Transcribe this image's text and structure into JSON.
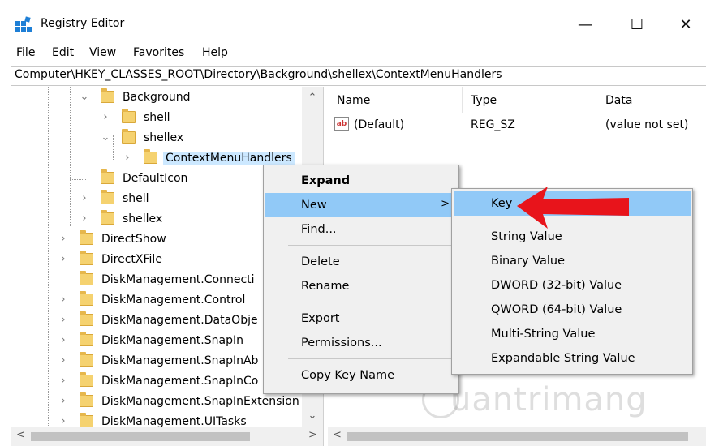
{
  "window": {
    "title": "Registry Editor",
    "controls": {
      "minimize": "—",
      "maximize": "☐",
      "close": "✕"
    }
  },
  "menubar": [
    "File",
    "Edit",
    "View",
    "Favorites",
    "Help"
  ],
  "address": "Computer\\HKEY_CLASSES_ROOT\\Directory\\Background\\shellex\\ContextMenuHandlers",
  "tree": [
    {
      "label": "Background",
      "expander": "⌄"
    },
    {
      "label": "shell",
      "expander": "›"
    },
    {
      "label": "shellex",
      "expander": "⌄"
    },
    {
      "label": "ContextMenuHandlers",
      "expander": "›",
      "selected": true
    },
    {
      "label": "DefaultIcon",
      "expander": ""
    },
    {
      "label": "shell",
      "expander": "›"
    },
    {
      "label": "shellex",
      "expander": "›"
    },
    {
      "label": "DirectShow",
      "expander": "›"
    },
    {
      "label": "DirectXFile",
      "expander": "›"
    },
    {
      "label": "DiskManagement.Connecti",
      "expander": ""
    },
    {
      "label": "DiskManagement.Control",
      "expander": "›"
    },
    {
      "label": "DiskManagement.DataObje",
      "expander": "›"
    },
    {
      "label": "DiskManagement.SnapIn",
      "expander": "›"
    },
    {
      "label": "DiskManagement.SnapInAb",
      "expander": "›"
    },
    {
      "label": "DiskManagement.SnapInCo",
      "expander": "›"
    },
    {
      "label": "DiskManagement.SnapInExtension",
      "expander": "›"
    },
    {
      "label": "DiskManagement.UITasks",
      "expander": "›"
    }
  ],
  "list": {
    "columns": [
      "Name",
      "Type",
      "Data"
    ],
    "rows": [
      {
        "icon": "ab",
        "name": "(Default)",
        "type": "REG_SZ",
        "data": "(value not set)"
      }
    ]
  },
  "context_menu": {
    "items": [
      "Expand",
      "New",
      "Find...",
      "Delete",
      "Rename",
      "Export",
      "Permissions...",
      "Copy Key Name"
    ],
    "submenu_arrow": ">"
  },
  "new_submenu": {
    "items": [
      "Key",
      "String Value",
      "Binary Value",
      "DWORD (32-bit) Value",
      "QWORD (64-bit) Value",
      "Multi-String Value",
      "Expandable String Value"
    ]
  },
  "scroll_glyphs": {
    "up": "⌃",
    "down": "⌄",
    "left": "<",
    "right": ">"
  },
  "watermark": "uantrimang",
  "colors": {
    "highlight": "#91c9f7",
    "selection": "#cce8ff",
    "arrow": "#e8141b",
    "folder": "#f5d270"
  }
}
